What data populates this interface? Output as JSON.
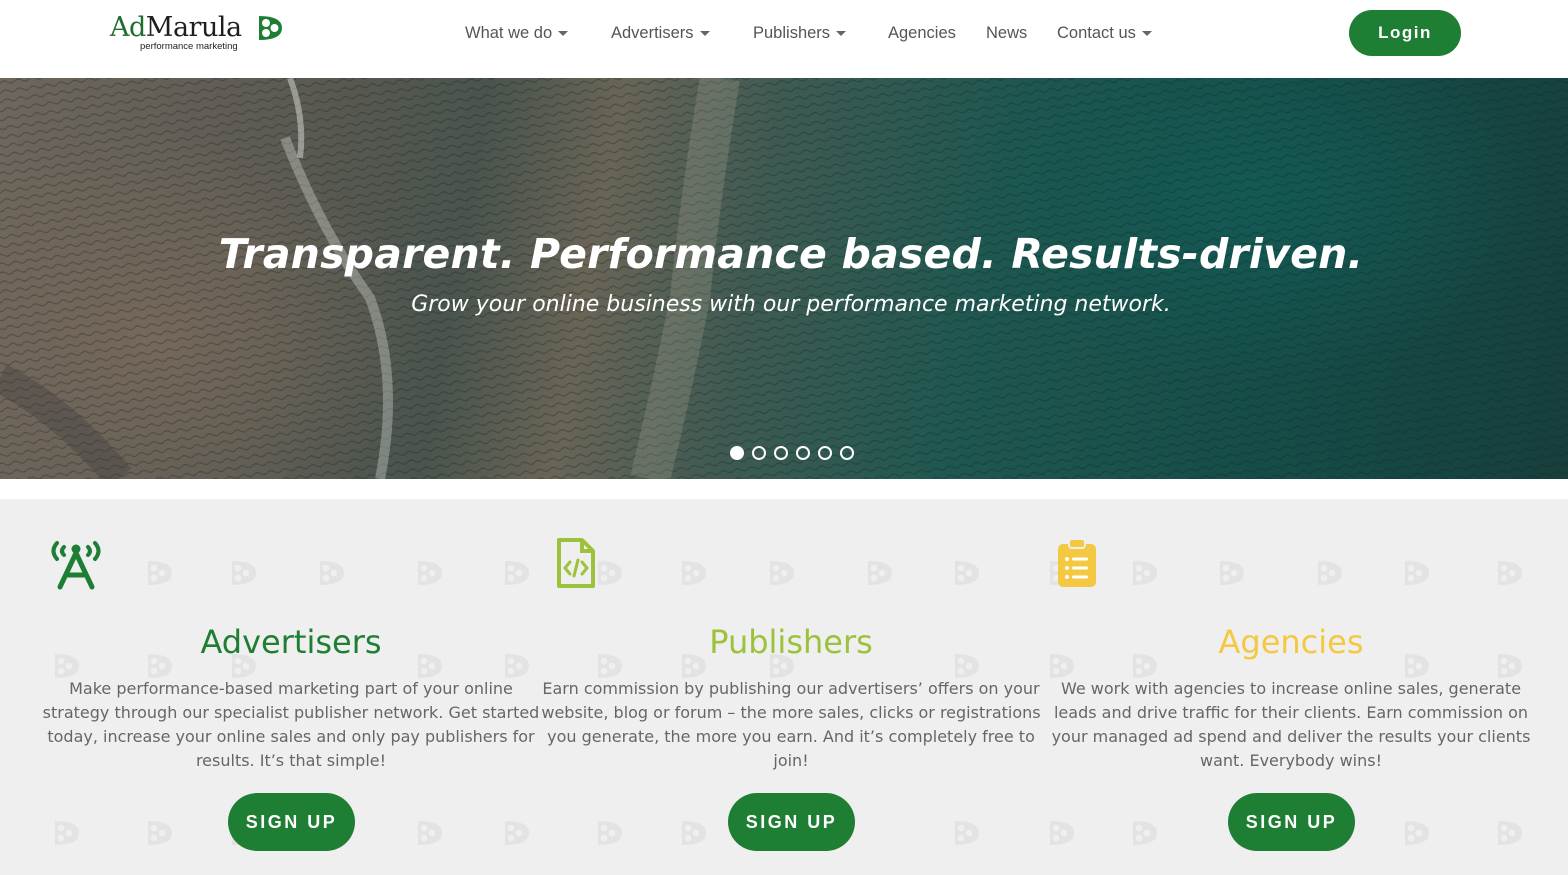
{
  "brand": {
    "name_part1": "Ad",
    "name_part2": "Marula",
    "tagline": "performance marketing",
    "logo_icon": "marula-fruit-logo-icon"
  },
  "nav": {
    "items": [
      {
        "label": "What we do",
        "dropdown": true
      },
      {
        "label": "Advertisers",
        "dropdown": true
      },
      {
        "label": "Publishers",
        "dropdown": true
      },
      {
        "label": "Agencies",
        "dropdown": false
      },
      {
        "label": "News",
        "dropdown": false
      },
      {
        "label": "Contact us",
        "dropdown": true
      }
    ],
    "login_label": "Login"
  },
  "hero": {
    "title": "Transparent. Performance based. Results-driven.",
    "subtitle": "Grow your online business with our performance marketing network.",
    "slide_count": 6,
    "active_slide": 1
  },
  "features": [
    {
      "title": "Advertisers",
      "text": "Make performance-based marketing part of your online strategy through our specialist publisher network. Get started today, increase your online sales and only pay publishers for results. It’s that simple!",
      "button": "SIGN UP",
      "icon": "broadcast-a-icon",
      "color": "#1e7e34"
    },
    {
      "title": "Publishers",
      "text": "Earn commission by publishing our advertisers’ offers on your website, blog or forum – the more sales, clicks or registrations you generate, the more you earn. And it’s completely free to join!",
      "button": "SIGN UP",
      "icon": "code-file-icon",
      "color": "#9bc23a"
    },
    {
      "title": "Agencies",
      "text": "We work with agencies to increase online sales, generate leads and drive traffic for their clients. Earn commission on your managed ad spend and deliver the results your clients want. Everybody wins!",
      "button": "SIGN UP",
      "icon": "clipboard-list-icon",
      "color": "#f5c842"
    }
  ],
  "colors": {
    "brand_green": "#1e7e34",
    "publisher_lime": "#9bc23a",
    "agency_yellow": "#f5c842",
    "section_bg": "#efefef"
  }
}
